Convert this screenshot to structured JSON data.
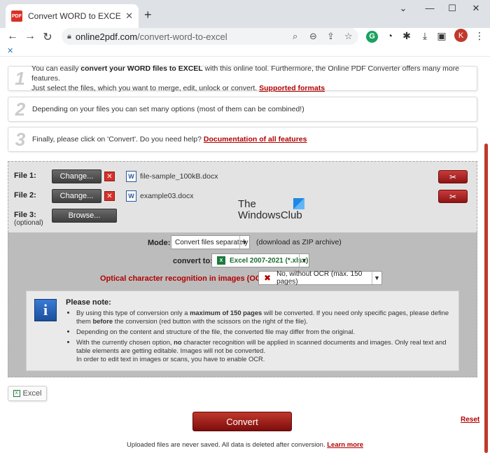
{
  "browser": {
    "tab_title": "Convert WORD to EXCEL online",
    "favicon_label": "PDF",
    "url_host": "online2pdf.com",
    "url_path": "/convert-word-to-excel",
    "avatar_letter": "K"
  },
  "steps": [
    {
      "number": "1",
      "line1_pre": "You can easily ",
      "line1_bold": "convert your WORD files to EXCEL",
      "line1_post": " with this online tool. Furthermore, the Online PDF Converter offers many more features.",
      "line2_pre": "Just select the files, which you want to merge, edit, unlock or convert. ",
      "link": "Supported formats"
    },
    {
      "number": "2",
      "text": "Depending on your files you can set many options (most of them can be combined!)"
    },
    {
      "number": "3",
      "text_pre": "Finally, please click on 'Convert'. Do you need help? ",
      "link": "Documentation of all features"
    }
  ],
  "files": [
    {
      "label": "File 1:",
      "button": "Change...",
      "name": "file-sample_100kB.docx"
    },
    {
      "label": "File 2:",
      "button": "Change...",
      "name": "example03.docx"
    },
    {
      "label": "File 3:",
      "sublabel": "(optional)",
      "button": "Browse..."
    }
  ],
  "watermark": {
    "line1": "The",
    "line2": "WindowsClub"
  },
  "options": {
    "mode_label": "Mode:",
    "mode_value": "Convert files separately",
    "mode_note": "(download as ZIP archive)",
    "convert_label": "convert to:",
    "convert_value": "Excel 2007-2021 (*.xlsx)",
    "ocr_label": "Optical character recognition in images (OCR):",
    "ocr_value": "No, without OCR (max. 150 pages)"
  },
  "note": {
    "title": "Please note:",
    "b1_pre": "By using this type of conversion only a ",
    "b1_bold1": "maximum of 150 pages",
    "b1_mid": " will be converted. If you need only specific pages, please define them ",
    "b1_bold2": "before",
    "b1_post": " the conversion (red button with the scissors on the right of the file).",
    "b2": "Depending on the content and structure of the file, the converted file may differ from the original.",
    "b3_pre": "With the currently chosen option, ",
    "b3_bold": "no",
    "b3_post": " character recognition will be applied in scanned documents and images. Only real text and table elements are getting editable. Images will not be converted.",
    "b3_line2": "In order to edit text in images or scans, you have to enable OCR."
  },
  "footer": {
    "excel_button": "Excel",
    "convert_button": "Convert",
    "reset": "Reset",
    "disclaimer": "Uploaded files are never saved. All data is deleted after conversion. ",
    "learn_more": "Learn more"
  }
}
